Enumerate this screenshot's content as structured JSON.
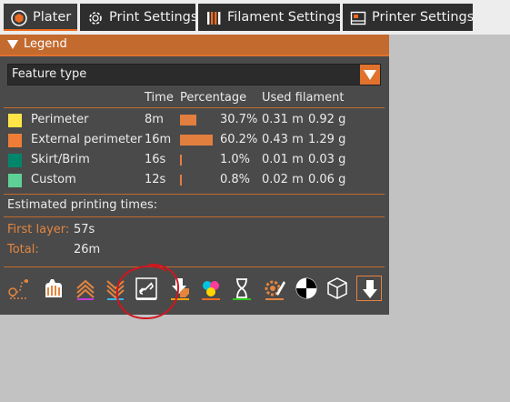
{
  "tabs": [
    {
      "label": "Plater",
      "icon": "plater-icon"
    },
    {
      "label": "Print Settings",
      "icon": "print-settings-icon"
    },
    {
      "label": "Filament Settings",
      "icon": "filament-settings-icon"
    },
    {
      "label": "Printer Settings",
      "icon": "printer-settings-icon"
    }
  ],
  "legend": {
    "title": "Legend",
    "view_type": "Feature type",
    "headers": {
      "time": "Time",
      "percentage": "Percentage",
      "used_filament": "Used filament"
    },
    "rows": [
      {
        "name": "Perimeter",
        "color": "#ffe548",
        "time": "8m",
        "percent": "30.7%",
        "percent_value": 30.7,
        "length": "0.31 m",
        "weight": "0.92 g"
      },
      {
        "name": "External perimeter",
        "color": "#ef7d37",
        "time": "16m",
        "percent": "60.2%",
        "percent_value": 60.2,
        "length": "0.43 m",
        "weight": "1.29 g"
      },
      {
        "name": "Skirt/Brim",
        "color": "#00876b",
        "time": "16s",
        "percent": "1.0%",
        "percent_value": 1.0,
        "length": "0.01 m",
        "weight": "0.03 g"
      },
      {
        "name": "Custom",
        "color": "#5ed196",
        "time": "12s",
        "percent": "0.8%",
        "percent_value": 0.8,
        "length": "0.02 m",
        "weight": "0.06 g"
      }
    ],
    "estimated_label": "Estimated printing times:",
    "first_layer_label": "First layer:",
    "first_layer_value": "57s",
    "total_label": "Total:",
    "total_value": "26m"
  },
  "toolbar": {
    "icons": [
      "travel-icon",
      "wipe-icon",
      "retractions-icon",
      "deretractions-icon",
      "seams-icon",
      "tool-changes-icon",
      "color-changes-icon",
      "pause-prints-icon",
      "custom-gcodes-icon",
      "center-of-gravity-icon",
      "shells-icon",
      "tool-marker-icon"
    ]
  },
  "colors": {
    "accent": "#e0722d",
    "panel_bg": "#4a4a4a",
    "annotation": "#d0161f"
  }
}
